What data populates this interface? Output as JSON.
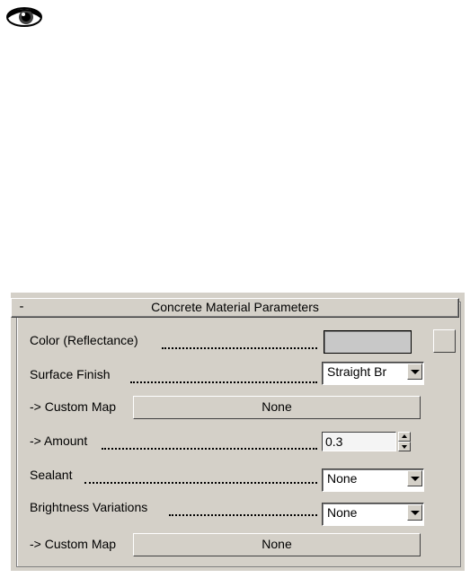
{
  "icons": {
    "top_icon": "eye-icon"
  },
  "rollout": {
    "collapse_symbol": "-",
    "title": "Concrete Material Parameters",
    "color": {
      "label": "Color (Reflectance)",
      "swatch_color": "#c8c8c8"
    },
    "surface_finish": {
      "label": "Surface Finish",
      "selected": "Straight Br"
    },
    "surface_custom_map": {
      "label": "-> Custom Map",
      "button": "None"
    },
    "amount": {
      "label": "-> Amount",
      "value": "0.3"
    },
    "sealant": {
      "label": "Sealant",
      "selected": "None"
    },
    "brightness_variations": {
      "label": "Brightness Variations",
      "selected": "None"
    },
    "brightness_custom_map": {
      "label": "-> Custom Map",
      "button": "None"
    }
  },
  "colors": {
    "panel_bg": "#d4d0c8",
    "swatch": "#c8c8c8"
  }
}
